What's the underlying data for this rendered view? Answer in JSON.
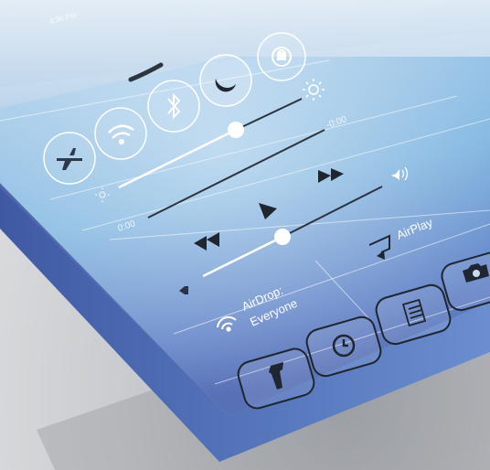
{
  "status_bar": {
    "time": "4:36 PM"
  },
  "control_center": {
    "toggles": [
      {
        "name": "airplane-mode",
        "icon": "airplane-icon"
      },
      {
        "name": "wifi",
        "icon": "wifi-icon"
      },
      {
        "name": "bluetooth",
        "icon": "bluetooth-icon"
      },
      {
        "name": "do-not-disturb",
        "icon": "moon-icon"
      },
      {
        "name": "rotation-lock",
        "icon": "rotation-lock-icon"
      }
    ],
    "brightness": {
      "level": 0.72
    },
    "music": {
      "elapsed": "0:00",
      "remaining": "-0:00",
      "scrubber_position": 0.0
    },
    "volume": {
      "level": 0.45
    },
    "airdrop": {
      "label": "AirDrop:",
      "value": "Everyone"
    },
    "airplay": {
      "label": "AirPlay"
    },
    "quick_launch": [
      {
        "name": "flashlight",
        "icon": "flashlight-icon"
      },
      {
        "name": "timer",
        "icon": "timer-icon"
      },
      {
        "name": "calculator",
        "icon": "calculator-icon"
      },
      {
        "name": "camera",
        "icon": "camera-icon"
      }
    ],
    "colors": {
      "glass_top": "#c8d9ec",
      "glass_mid": "#6fa6d4",
      "glass_bottom": "#4f6fb8",
      "line": "#ffffff"
    }
  }
}
